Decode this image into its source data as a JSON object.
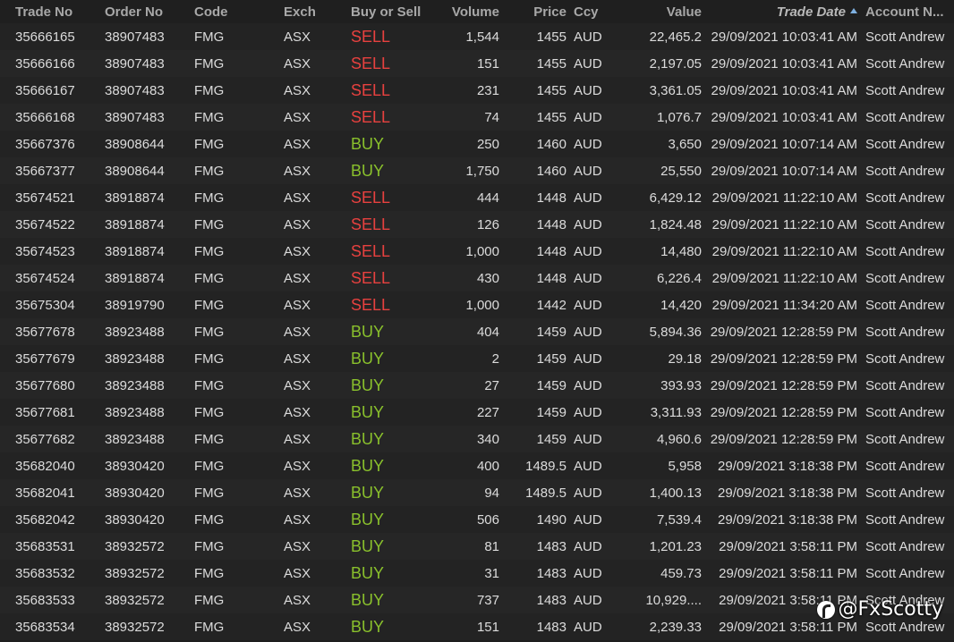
{
  "columns": {
    "trade_no": "Trade No",
    "order_no": "Order No",
    "code": "Code",
    "exch": "Exch",
    "side": "Buy or Sell",
    "volume": "Volume",
    "price": "Price",
    "ccy": "Ccy",
    "value": "Value",
    "trade_date": "Trade Date",
    "account": "Account N..."
  },
  "sort": {
    "column": "trade_date",
    "direction": "ascending"
  },
  "colors": {
    "sell": "#e8413f",
    "buy": "#8ac12c",
    "background": "#1e1e1e",
    "text": "#dcdcdc"
  },
  "rows": [
    {
      "trade_no": "35666165",
      "order_no": "38907483",
      "code": "FMG",
      "exch": "ASX",
      "side": "SELL",
      "volume": "1,544",
      "price": "1455",
      "ccy": "AUD",
      "value": "22,465.2",
      "trade_date": "29/09/2021 10:03:41 AM",
      "account": "Scott Andrew"
    },
    {
      "trade_no": "35666166",
      "order_no": "38907483",
      "code": "FMG",
      "exch": "ASX",
      "side": "SELL",
      "volume": "151",
      "price": "1455",
      "ccy": "AUD",
      "value": "2,197.05",
      "trade_date": "29/09/2021 10:03:41 AM",
      "account": "Scott Andrew"
    },
    {
      "trade_no": "35666167",
      "order_no": "38907483",
      "code": "FMG",
      "exch": "ASX",
      "side": "SELL",
      "volume": "231",
      "price": "1455",
      "ccy": "AUD",
      "value": "3,361.05",
      "trade_date": "29/09/2021 10:03:41 AM",
      "account": "Scott Andrew"
    },
    {
      "trade_no": "35666168",
      "order_no": "38907483",
      "code": "FMG",
      "exch": "ASX",
      "side": "SELL",
      "volume": "74",
      "price": "1455",
      "ccy": "AUD",
      "value": "1,076.7",
      "trade_date": "29/09/2021 10:03:41 AM",
      "account": "Scott Andrew"
    },
    {
      "trade_no": "35667376",
      "order_no": "38908644",
      "code": "FMG",
      "exch": "ASX",
      "side": "BUY",
      "volume": "250",
      "price": "1460",
      "ccy": "AUD",
      "value": "3,650",
      "trade_date": "29/09/2021 10:07:14 AM",
      "account": "Scott Andrew"
    },
    {
      "trade_no": "35667377",
      "order_no": "38908644",
      "code": "FMG",
      "exch": "ASX",
      "side": "BUY",
      "volume": "1,750",
      "price": "1460",
      "ccy": "AUD",
      "value": "25,550",
      "trade_date": "29/09/2021 10:07:14 AM",
      "account": "Scott Andrew"
    },
    {
      "trade_no": "35674521",
      "order_no": "38918874",
      "code": "FMG",
      "exch": "ASX",
      "side": "SELL",
      "volume": "444",
      "price": "1448",
      "ccy": "AUD",
      "value": "6,429.12",
      "trade_date": "29/09/2021 11:22:10 AM",
      "account": "Scott Andrew"
    },
    {
      "trade_no": "35674522",
      "order_no": "38918874",
      "code": "FMG",
      "exch": "ASX",
      "side": "SELL",
      "volume": "126",
      "price": "1448",
      "ccy": "AUD",
      "value": "1,824.48",
      "trade_date": "29/09/2021 11:22:10 AM",
      "account": "Scott Andrew"
    },
    {
      "trade_no": "35674523",
      "order_no": "38918874",
      "code": "FMG",
      "exch": "ASX",
      "side": "SELL",
      "volume": "1,000",
      "price": "1448",
      "ccy": "AUD",
      "value": "14,480",
      "trade_date": "29/09/2021 11:22:10 AM",
      "account": "Scott Andrew"
    },
    {
      "trade_no": "35674524",
      "order_no": "38918874",
      "code": "FMG",
      "exch": "ASX",
      "side": "SELL",
      "volume": "430",
      "price": "1448",
      "ccy": "AUD",
      "value": "6,226.4",
      "trade_date": "29/09/2021 11:22:10 AM",
      "account": "Scott Andrew"
    },
    {
      "trade_no": "35675304",
      "order_no": "38919790",
      "code": "FMG",
      "exch": "ASX",
      "side": "SELL",
      "volume": "1,000",
      "price": "1442",
      "ccy": "AUD",
      "value": "14,420",
      "trade_date": "29/09/2021 11:34:20 AM",
      "account": "Scott Andrew"
    },
    {
      "trade_no": "35677678",
      "order_no": "38923488",
      "code": "FMG",
      "exch": "ASX",
      "side": "BUY",
      "volume": "404",
      "price": "1459",
      "ccy": "AUD",
      "value": "5,894.36",
      "trade_date": "29/09/2021 12:28:59 PM",
      "account": "Scott Andrew"
    },
    {
      "trade_no": "35677679",
      "order_no": "38923488",
      "code": "FMG",
      "exch": "ASX",
      "side": "BUY",
      "volume": "2",
      "price": "1459",
      "ccy": "AUD",
      "value": "29.18",
      "trade_date": "29/09/2021 12:28:59 PM",
      "account": "Scott Andrew"
    },
    {
      "trade_no": "35677680",
      "order_no": "38923488",
      "code": "FMG",
      "exch": "ASX",
      "side": "BUY",
      "volume": "27",
      "price": "1459",
      "ccy": "AUD",
      "value": "393.93",
      "trade_date": "29/09/2021 12:28:59 PM",
      "account": "Scott Andrew"
    },
    {
      "trade_no": "35677681",
      "order_no": "38923488",
      "code": "FMG",
      "exch": "ASX",
      "side": "BUY",
      "volume": "227",
      "price": "1459",
      "ccy": "AUD",
      "value": "3,311.93",
      "trade_date": "29/09/2021 12:28:59 PM",
      "account": "Scott Andrew"
    },
    {
      "trade_no": "35677682",
      "order_no": "38923488",
      "code": "FMG",
      "exch": "ASX",
      "side": "BUY",
      "volume": "340",
      "price": "1459",
      "ccy": "AUD",
      "value": "4,960.6",
      "trade_date": "29/09/2021 12:28:59 PM",
      "account": "Scott Andrew"
    },
    {
      "trade_no": "35682040",
      "order_no": "38930420",
      "code": "FMG",
      "exch": "ASX",
      "side": "BUY",
      "volume": "400",
      "price": "1489.5",
      "ccy": "AUD",
      "value": "5,958",
      "trade_date": "29/09/2021 3:18:38 PM",
      "account": "Scott Andrew"
    },
    {
      "trade_no": "35682041",
      "order_no": "38930420",
      "code": "FMG",
      "exch": "ASX",
      "side": "BUY",
      "volume": "94",
      "price": "1489.5",
      "ccy": "AUD",
      "value": "1,400.13",
      "trade_date": "29/09/2021 3:18:38 PM",
      "account": "Scott Andrew"
    },
    {
      "trade_no": "35682042",
      "order_no": "38930420",
      "code": "FMG",
      "exch": "ASX",
      "side": "BUY",
      "volume": "506",
      "price": "1490",
      "ccy": "AUD",
      "value": "7,539.4",
      "trade_date": "29/09/2021 3:18:38 PM",
      "account": "Scott Andrew"
    },
    {
      "trade_no": "35683531",
      "order_no": "38932572",
      "code": "FMG",
      "exch": "ASX",
      "side": "BUY",
      "volume": "81",
      "price": "1483",
      "ccy": "AUD",
      "value": "1,201.23",
      "trade_date": "29/09/2021 3:58:11 PM",
      "account": "Scott Andrew"
    },
    {
      "trade_no": "35683532",
      "order_no": "38932572",
      "code": "FMG",
      "exch": "ASX",
      "side": "BUY",
      "volume": "31",
      "price": "1483",
      "ccy": "AUD",
      "value": "459.73",
      "trade_date": "29/09/2021 3:58:11 PM",
      "account": "Scott Andrew"
    },
    {
      "trade_no": "35683533",
      "order_no": "38932572",
      "code": "FMG",
      "exch": "ASX",
      "side": "BUY",
      "volume": "737",
      "price": "1483",
      "ccy": "AUD",
      "value": "10,929....",
      "trade_date": "29/09/2021 3:58:11 PM",
      "account": "Scott Andrew"
    },
    {
      "trade_no": "35683534",
      "order_no": "38932572",
      "code": "FMG",
      "exch": "ASX",
      "side": "BUY",
      "volume": "151",
      "price": "1483",
      "ccy": "AUD",
      "value": "2,239.33",
      "trade_date": "29/09/2021 3:58:11 PM",
      "account": "Scott Andrew"
    }
  ],
  "watermark": {
    "text": "@FxScotty",
    "icon": "circle-logo-icon"
  }
}
